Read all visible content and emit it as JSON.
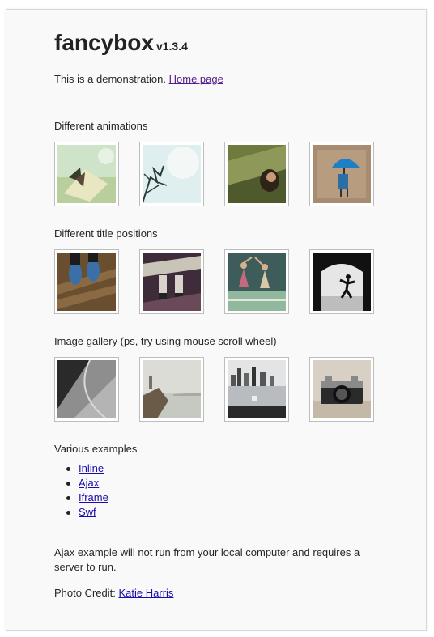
{
  "header": {
    "title": "fancybox",
    "version": "v1.3.4"
  },
  "intro": {
    "text": "This is a demonstration.",
    "link_label": "Home page"
  },
  "sections": {
    "animations": {
      "title": "Different animations",
      "thumbs": [
        "butterfly",
        "bare-tree-branches",
        "grass-portrait",
        "blue-umbrella"
      ]
    },
    "title_positions": {
      "title": "Different title positions",
      "thumbs": [
        "shoes-on-bench",
        "boots-on-bench",
        "jumping-friends",
        "tunnel-silhouette"
      ]
    },
    "gallery": {
      "title": "Image gallery (ps, try using mouse scroll wheel)",
      "thumbs": [
        "pavement-shadow",
        "lighthouse-coast",
        "city-skyline-pier",
        "vintage-camera"
      ]
    },
    "examples": {
      "title": "Various examples",
      "items": [
        "Inline",
        "Ajax",
        "Iframe",
        "Swf"
      ]
    }
  },
  "footer": {
    "ajax_note": "Ajax example will not run from your local computer and requires a server to run.",
    "credit_label": "Photo Credit:",
    "credit_name": "Katie Harris"
  }
}
